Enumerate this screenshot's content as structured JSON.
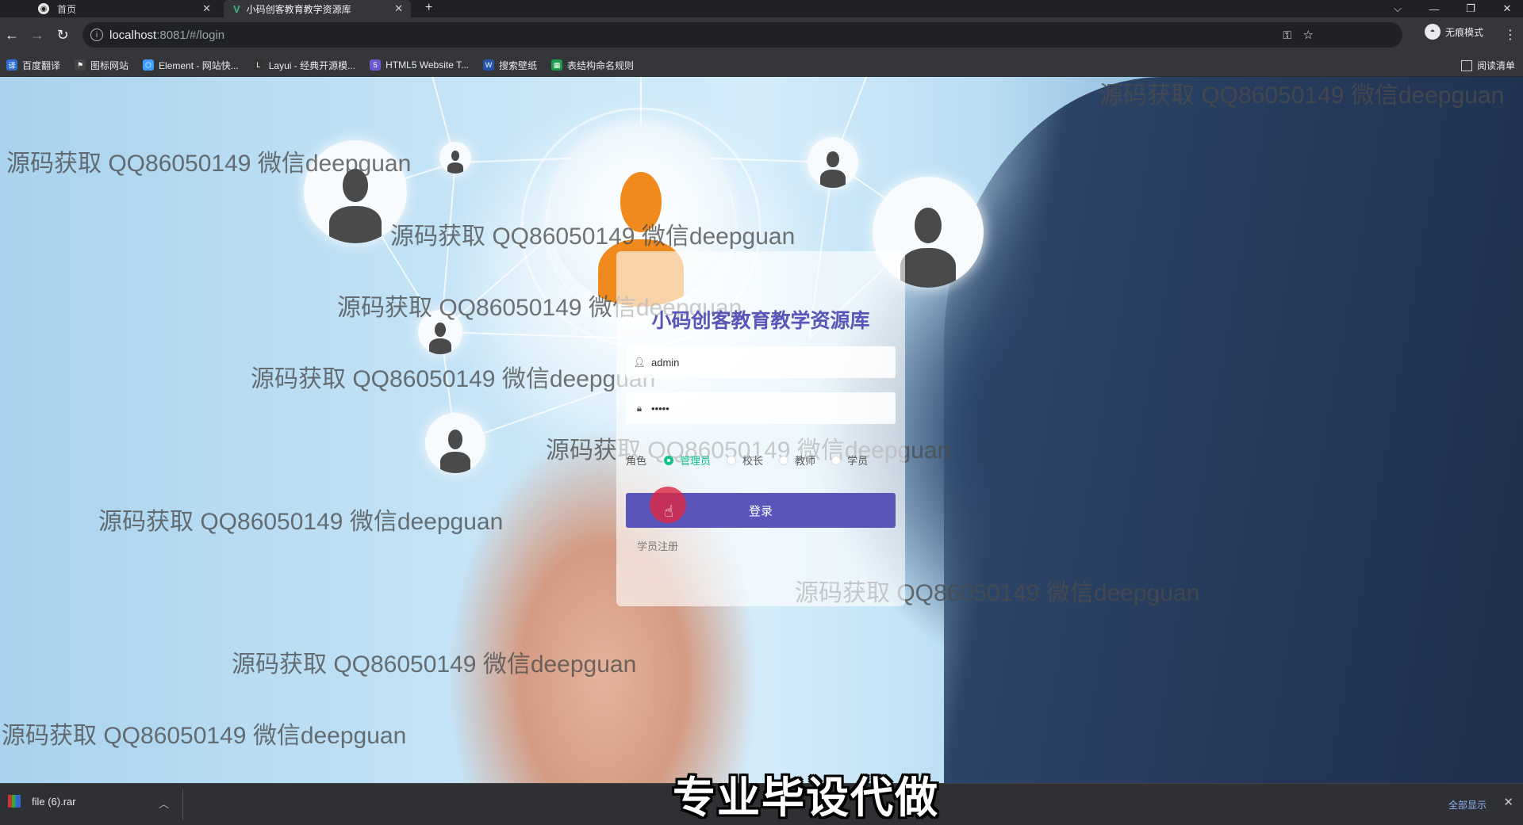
{
  "browser": {
    "tabs": [
      {
        "label": "首页"
      },
      {
        "label": "小码创客教育教学资源库"
      }
    ],
    "new_tab_label": "+",
    "window_controls": {
      "dropdown": "⌵",
      "minimize": "—",
      "restore": "❐",
      "close": "✕"
    },
    "address": {
      "host": "localhost",
      "rest": ":8081/#/login"
    },
    "incognito_label": "无痕模式",
    "bookmarks": [
      {
        "label": "百度翻译",
        "icon": "baidu-translate-icon",
        "color": "#2f6fd6"
      },
      {
        "label": "图标网站",
        "icon": "flag-icon",
        "color": "#444444"
      },
      {
        "label": "Element - 网站快...",
        "icon": "element-icon",
        "color": "#409eff"
      },
      {
        "label": "Layui - 经典开源模...",
        "icon": "layui-icon",
        "color": "#333333"
      },
      {
        "label": "HTML5 Website T...",
        "icon": "html5-icon",
        "color": "#6a5acd"
      },
      {
        "label": "搜索壁纸",
        "icon": "wallpaper-icon",
        "color": "#2255aa"
      },
      {
        "label": "表结构命名规则",
        "icon": "table-icon",
        "color": "#1e9e4a"
      }
    ],
    "reading_list_label": "阅读清单"
  },
  "watermark_text": "源码获取 QQ86050149 微信deepguan",
  "login": {
    "title": "小码创客教育教学资源库",
    "username": "admin",
    "password_mask": "•••••",
    "role_label": "角色",
    "roles": [
      {
        "label": "管理员",
        "selected": true
      },
      {
        "label": "校长",
        "selected": false
      },
      {
        "label": "教师",
        "selected": false
      },
      {
        "label": "学员",
        "selected": false
      }
    ],
    "login_button": "登录",
    "register_link": "学员注册"
  },
  "download": {
    "file": "file (6).rar",
    "show_all": "全部显示"
  },
  "caption": "专业毕设代做",
  "colors": {
    "accent": "#5a55b8",
    "radio_selected": "#13c08a",
    "title": "#5a55b8"
  }
}
